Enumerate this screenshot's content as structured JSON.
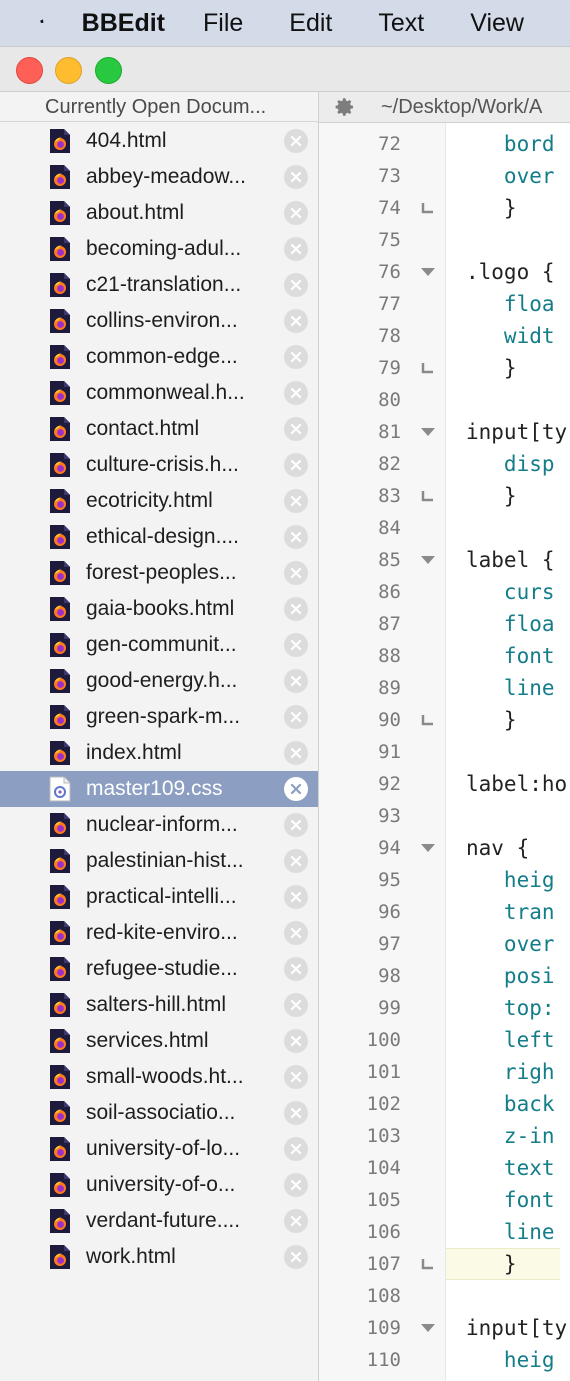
{
  "menubar": {
    "app_name": "BBEdit",
    "items": [
      "File",
      "Edit",
      "Text",
      "View"
    ]
  },
  "sidebar": {
    "header": "Currently Open Docum...",
    "documents": [
      {
        "name": "404.html",
        "type": "html"
      },
      {
        "name": "abbey-meadow...",
        "type": "html"
      },
      {
        "name": "about.html",
        "type": "html"
      },
      {
        "name": "becoming-adul...",
        "type": "html"
      },
      {
        "name": "c21-translation...",
        "type": "html"
      },
      {
        "name": "collins-environ...",
        "type": "html"
      },
      {
        "name": "common-edge...",
        "type": "html"
      },
      {
        "name": "commonweal.h...",
        "type": "html"
      },
      {
        "name": "contact.html",
        "type": "html"
      },
      {
        "name": "culture-crisis.h...",
        "type": "html"
      },
      {
        "name": "ecotricity.html",
        "type": "html"
      },
      {
        "name": "ethical-design....",
        "type": "html"
      },
      {
        "name": "forest-peoples...",
        "type": "html"
      },
      {
        "name": "gaia-books.html",
        "type": "html"
      },
      {
        "name": "gen-communit...",
        "type": "html"
      },
      {
        "name": "good-energy.h...",
        "type": "html"
      },
      {
        "name": "green-spark-m...",
        "type": "html"
      },
      {
        "name": "index.html",
        "type": "html"
      },
      {
        "name": "master109.css",
        "type": "css",
        "selected": true
      },
      {
        "name": "nuclear-inform...",
        "type": "html"
      },
      {
        "name": "palestinian-hist...",
        "type": "html"
      },
      {
        "name": "practical-intelli...",
        "type": "html"
      },
      {
        "name": "red-kite-enviro...",
        "type": "html"
      },
      {
        "name": "refugee-studie...",
        "type": "html"
      },
      {
        "name": "salters-hill.html",
        "type": "html"
      },
      {
        "name": "services.html",
        "type": "html"
      },
      {
        "name": "small-woods.ht...",
        "type": "html"
      },
      {
        "name": "soil-associatio...",
        "type": "html"
      },
      {
        "name": "university-of-lo...",
        "type": "html"
      },
      {
        "name": "university-of-o...",
        "type": "html"
      },
      {
        "name": "verdant-future....",
        "type": "html"
      },
      {
        "name": "work.html",
        "type": "html"
      }
    ]
  },
  "editor": {
    "path": "~/Desktop/Work/A",
    "current_line": 107,
    "lines": [
      {
        "n": "72",
        "text": "   bord",
        "kind": "prop",
        "fold": ""
      },
      {
        "n": "73",
        "text": "   over",
        "kind": "prop",
        "fold": ""
      },
      {
        "n": "74",
        "text": "   }",
        "kind": "plain",
        "fold": "end"
      },
      {
        "n": "75",
        "text": "",
        "kind": "plain",
        "fold": ""
      },
      {
        "n": "76",
        "text": ".logo {",
        "kind": "plain",
        "fold": "start"
      },
      {
        "n": "77",
        "text": "   floa",
        "kind": "prop",
        "fold": ""
      },
      {
        "n": "78",
        "text": "   widt",
        "kind": "prop",
        "fold": ""
      },
      {
        "n": "79",
        "text": "   }",
        "kind": "plain",
        "fold": "end"
      },
      {
        "n": "80",
        "text": "",
        "kind": "plain",
        "fold": ""
      },
      {
        "n": "81",
        "text": "input[ty",
        "kind": "plain",
        "fold": "start"
      },
      {
        "n": "82",
        "text": "   disp",
        "kind": "prop",
        "fold": ""
      },
      {
        "n": "83",
        "text": "   }",
        "kind": "plain",
        "fold": "end"
      },
      {
        "n": "84",
        "text": "",
        "kind": "plain",
        "fold": ""
      },
      {
        "n": "85",
        "text": "label {",
        "kind": "plain",
        "fold": "start"
      },
      {
        "n": "86",
        "text": "   curs",
        "kind": "prop",
        "fold": ""
      },
      {
        "n": "87",
        "text": "   floa",
        "kind": "prop",
        "fold": ""
      },
      {
        "n": "88",
        "text": "   font",
        "kind": "prop",
        "fold": ""
      },
      {
        "n": "89",
        "text": "   line",
        "kind": "prop",
        "fold": ""
      },
      {
        "n": "90",
        "text": "   }",
        "kind": "plain",
        "fold": "end"
      },
      {
        "n": "91",
        "text": "",
        "kind": "plain",
        "fold": ""
      },
      {
        "n": "92",
        "text": "label:ho",
        "kind": "plain",
        "fold": ""
      },
      {
        "n": "93",
        "text": "",
        "kind": "plain",
        "fold": ""
      },
      {
        "n": "94",
        "text": "nav {",
        "kind": "plain",
        "fold": "start"
      },
      {
        "n": "95",
        "text": "   heig",
        "kind": "prop",
        "fold": ""
      },
      {
        "n": "96",
        "text": "   tran",
        "kind": "prop",
        "fold": ""
      },
      {
        "n": "97",
        "text": "   over",
        "kind": "prop",
        "fold": ""
      },
      {
        "n": "98",
        "text": "   posi",
        "kind": "prop",
        "fold": ""
      },
      {
        "n": "99",
        "text": "   top:",
        "kind": "prop",
        "fold": ""
      },
      {
        "n": "100",
        "text": "   left",
        "kind": "prop",
        "fold": ""
      },
      {
        "n": "101",
        "text": "   righ",
        "kind": "prop",
        "fold": ""
      },
      {
        "n": "102",
        "text": "   back",
        "kind": "prop",
        "fold": ""
      },
      {
        "n": "103",
        "text": "   z-in",
        "kind": "prop",
        "fold": ""
      },
      {
        "n": "104",
        "text": "   text",
        "kind": "prop",
        "fold": ""
      },
      {
        "n": "105",
        "text": "   font",
        "kind": "prop",
        "fold": ""
      },
      {
        "n": "106",
        "text": "   line",
        "kind": "prop",
        "fold": ""
      },
      {
        "n": "107",
        "text": "   }",
        "kind": "plain",
        "fold": "end"
      },
      {
        "n": "108",
        "text": "",
        "kind": "plain",
        "fold": ""
      },
      {
        "n": "109",
        "text": "input[ty",
        "kind": "plain",
        "fold": "start"
      },
      {
        "n": "110",
        "text": "   heig",
        "kind": "prop",
        "fold": ""
      }
    ]
  },
  "colors": {
    "menubar_bg": "#d3dbe9",
    "selection": "#8c9fc3",
    "code_property": "#137d8a",
    "firefox_doc_bg": "#1d1a3b"
  }
}
